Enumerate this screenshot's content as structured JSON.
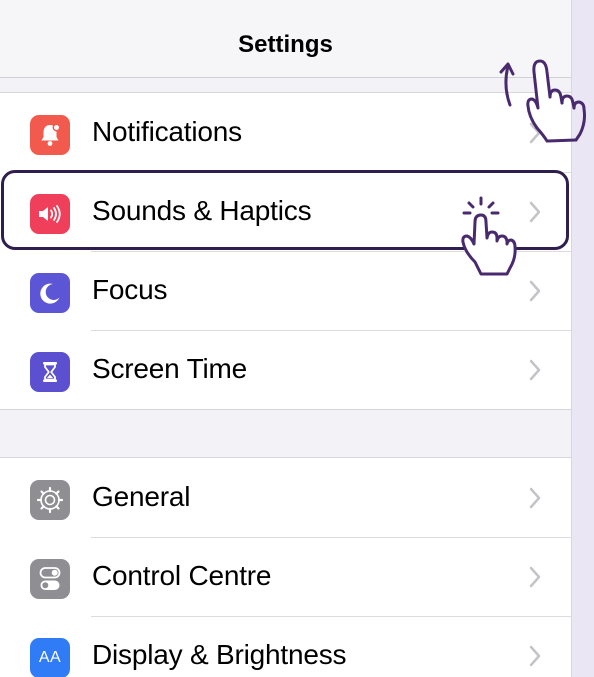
{
  "navbar": {
    "title": "Settings"
  },
  "groups": [
    {
      "items": [
        {
          "label": "Notifications",
          "icon": "notification-bell-icon",
          "color": "#f15a4d"
        },
        {
          "label": "Sounds & Haptics",
          "icon": "speaker-icon",
          "color": "#ef3f5a",
          "highlighted": true
        },
        {
          "label": "Focus",
          "icon": "moon-icon",
          "color": "#5c55d6"
        },
        {
          "label": "Screen Time",
          "icon": "hourglass-icon",
          "color": "#5c4fd0"
        }
      ]
    },
    {
      "items": [
        {
          "label": "General",
          "icon": "gear-icon",
          "color": "#8e8e93"
        },
        {
          "label": "Control Centre",
          "icon": "toggle-switches-icon",
          "color": "#8e8e93"
        },
        {
          "label": "Display & Brightness",
          "icon": "text-size-icon",
          "color": "#2f7cf6",
          "icon_text": "AA"
        }
      ]
    }
  ],
  "gestures": {
    "swipe": "swipe-up-hand-icon",
    "tap": "tap-hand-icon",
    "color": "#4a2a6e"
  }
}
